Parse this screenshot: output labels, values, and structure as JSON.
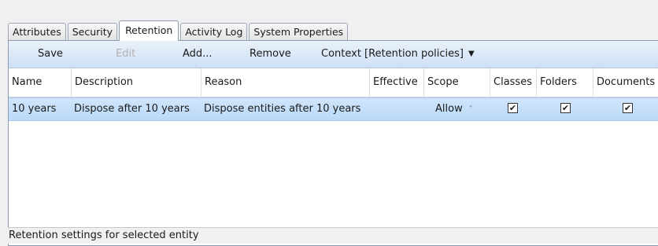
{
  "tabs": [
    {
      "label": "Attributes"
    },
    {
      "label": "Security"
    },
    {
      "label": "Retention"
    },
    {
      "label": "Activity Log"
    },
    {
      "label": "System Properties"
    }
  ],
  "toolbar": {
    "save": "Save",
    "edit": "Edit",
    "add": "Add...",
    "remove": "Remove",
    "context": "Context [Retention policies]"
  },
  "grid": {
    "columns": [
      "Name",
      "Description",
      "Reason",
      "Effective",
      "Scope",
      "Classes",
      "Folders",
      "Documents"
    ],
    "rows": [
      {
        "name": "10 years",
        "description": "Dispose after 10 years",
        "reason": "Dispose entities after 10 years",
        "effective": "",
        "scope": "Allow",
        "classes": true,
        "folders": true,
        "documents": true
      }
    ]
  },
  "status": "Retention settings for selected entity",
  "icons": {
    "check": "✔",
    "dropdown": "▼",
    "scope_dropdown": "˅"
  }
}
